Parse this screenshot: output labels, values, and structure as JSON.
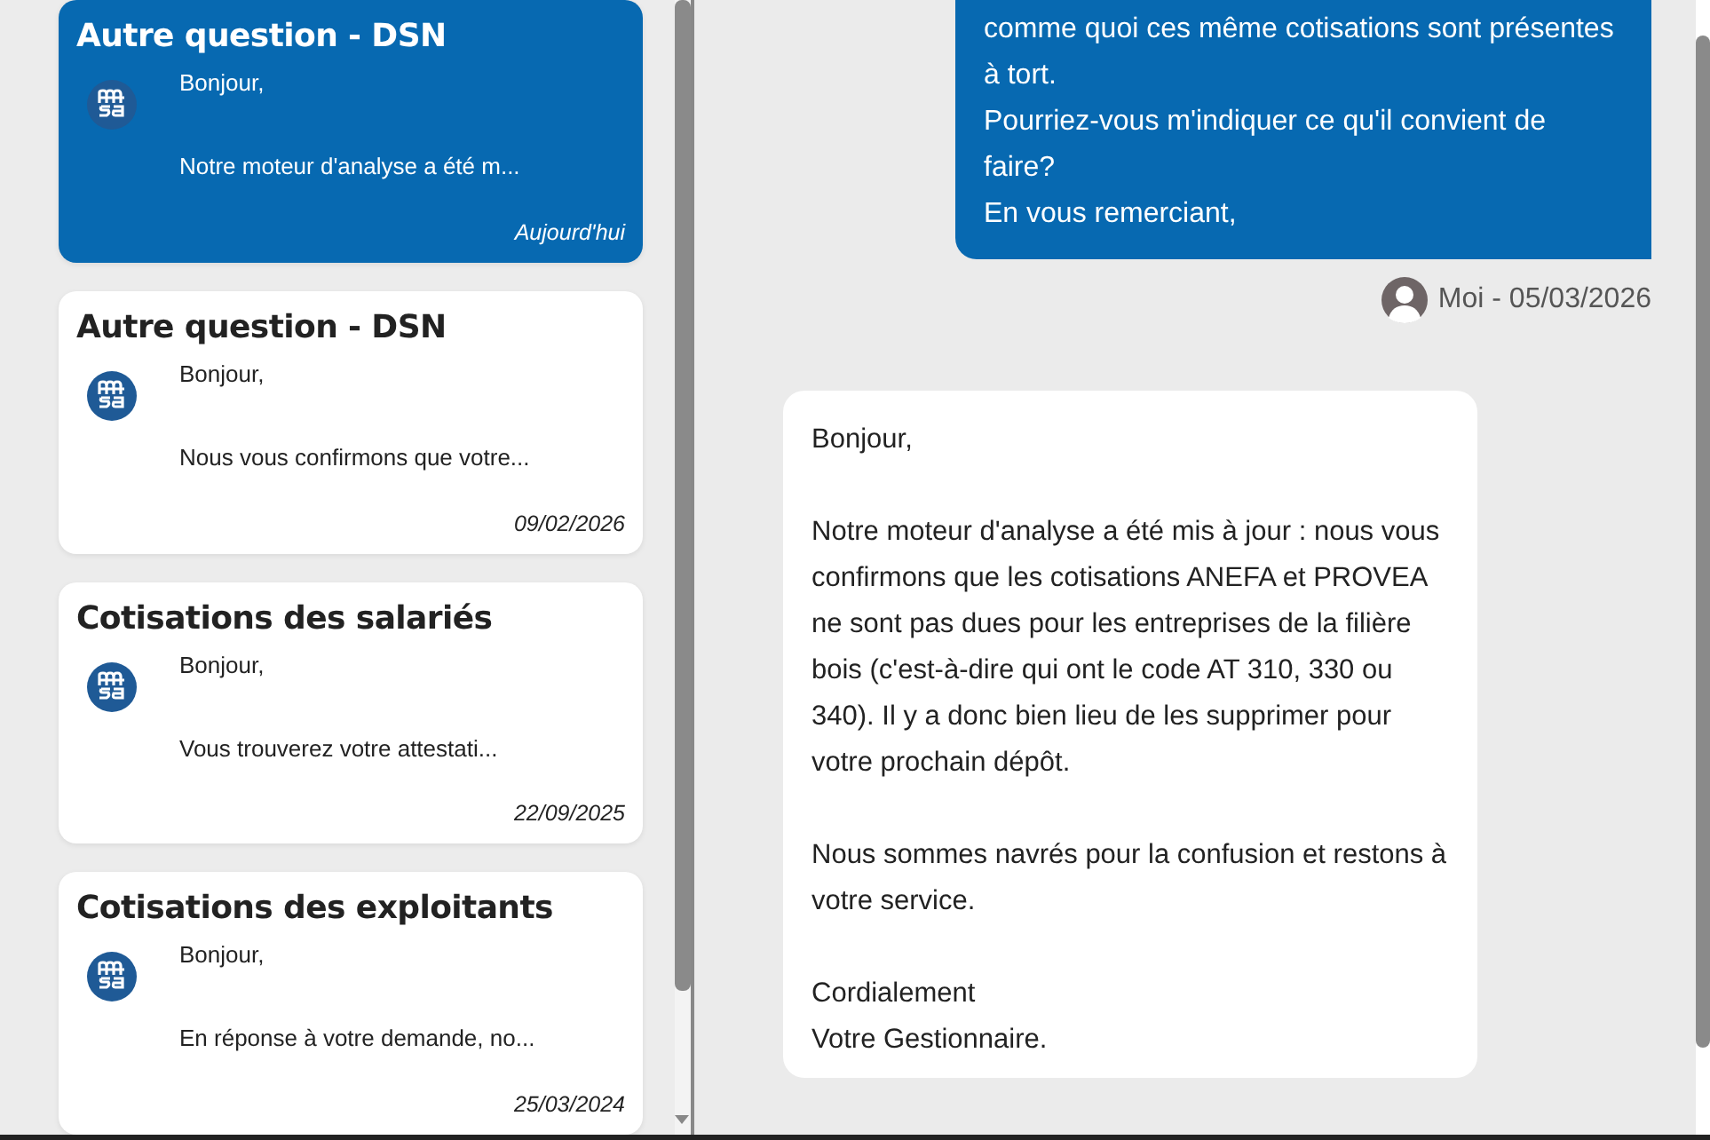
{
  "conversations": [
    {
      "title": "Autre question - DSN",
      "greeting": "Bonjour,",
      "preview": "Notre moteur d'analyse a été m...",
      "date": "Aujourd'hui",
      "selected": true
    },
    {
      "title": "Autre question - DSN",
      "greeting": "Bonjour,",
      "preview": "Nous vous confirmons que votre...",
      "date": "09/02/2026",
      "selected": false
    },
    {
      "title": "Cotisations des salariés",
      "greeting": "Bonjour,",
      "preview": "Vous trouverez votre attestati...",
      "date": "22/09/2025",
      "selected": false
    },
    {
      "title": "Cotisations des exploitants",
      "greeting": "Bonjour,",
      "preview": "En réponse à votre demande, no...",
      "date": "25/03/2024",
      "selected": false
    }
  ],
  "messages": [
    {
      "kind": "sent",
      "paragraphs": [
        "comme quoi ces même cotisations sont présentes à tort.",
        "Pourriez-vous m'indiquer ce qu'il convient de faire?",
        "En vous remerciant,"
      ],
      "meta": "Moi - 05/03/2026"
    },
    {
      "kind": "received",
      "paragraphs": [
        "Bonjour,",
        "Notre moteur d'analyse a été mis à jour : nous vous confirmons que les cotisations ANEFA et PROVEA ne sont pas dues pour les entreprises de la filière bois (c'est-à-dire qui ont le code AT 310, 330 ou 340). Il y a donc bien lieu de les supprimer pour votre prochain dépôt.",
        "Nous sommes navrés pour la confusion et restons à votre service.",
        "Cordialement\nVotre Gestionnaire."
      ]
    }
  ]
}
